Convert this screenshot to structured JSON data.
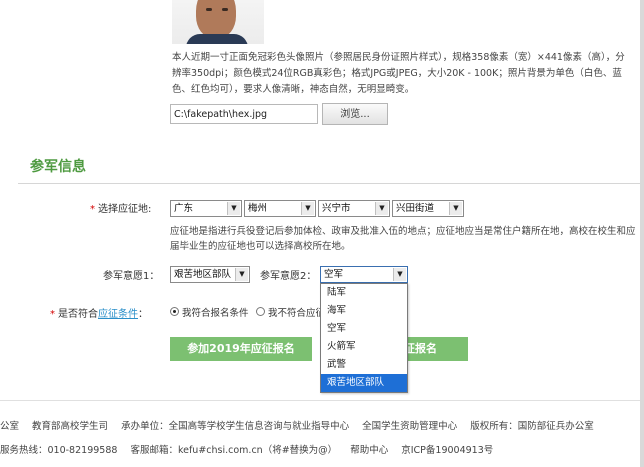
{
  "photo": {
    "requirement_text": "本人近期一寸正面免冠彩色头像照片（参照居民身份证照片样式），规格358像素（宽）×441像素（高），分辨率350dpi；颜色模式24位RGB真彩色；格式JPG或JPEG，大小20K - 100K；照片背景为单色（白色、蓝色、红色均可），要求人像清晰，神态自然，无明显畸变。",
    "file_path": "C:\\fakepath\\hex.jpg",
    "browse_label": "浏览..."
  },
  "section": {
    "title": "参军信息"
  },
  "location": {
    "label": "选择应征地:",
    "province": "广东",
    "city": "梅州",
    "district": "兴宁市",
    "street": "兴田街道",
    "note": "应征地是指进行兵役登记后参加体检、政审及批准入伍的地点；应征地应当是常住户籍所在地，高校在校生和应届毕业生的应征地也可以选择高校所在地。"
  },
  "wish": {
    "wish1_label": "参军意愿1：",
    "wish1_value": "艰苦地区部队",
    "wish2_label": "参军意愿2：",
    "wish2_value": "空军",
    "options": [
      "陆军",
      "海军",
      "空军",
      "火箭军",
      "武警",
      "艰苦地区部队"
    ],
    "highlighted_index": 5
  },
  "condition": {
    "label_prefix": "是否符合",
    "label_link": "应征条件",
    "label_suffix": "：",
    "option_yes": "我符合报名条件",
    "option_no": "我不符合应征"
  },
  "buttons": {
    "apply_2019": "参加2019年应征报名",
    "apply_other": "征报名"
  },
  "footer": {
    "line1": [
      "公室",
      "教育部高校学生司",
      "承办单位：全国高等学校学生信息咨询与就业指导中心",
      "全国学生资助管理中心",
      "版权所有：国防部征兵办公室"
    ],
    "line2": [
      "服务热线：010-82199588",
      "客服邮箱：kefu#chsi.com.cn（将#替换为@）",
      "帮助中心",
      "京ICP备19004913号"
    ]
  },
  "icons": {
    "dropdown_arrow": "chevron-down-icon",
    "radio": "radio-icon"
  }
}
